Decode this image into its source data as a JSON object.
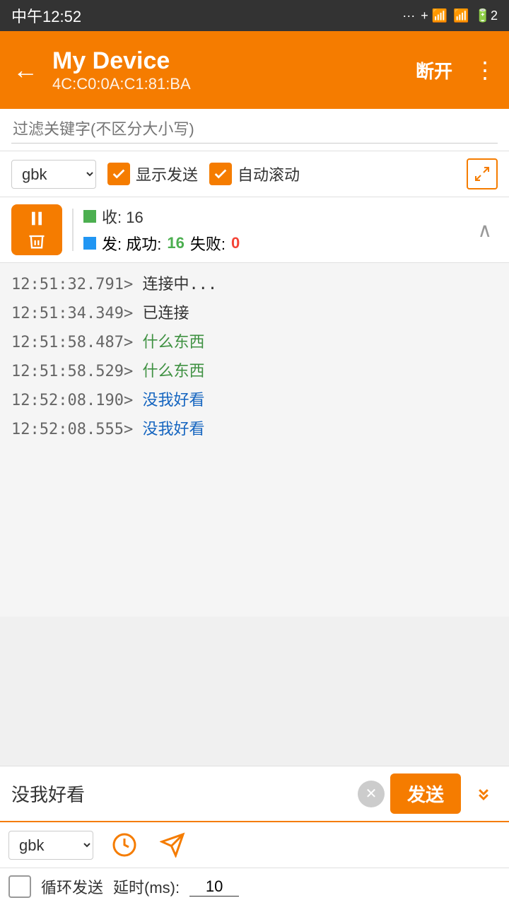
{
  "statusBar": {
    "time": "中午12:52",
    "battery": "2"
  },
  "topBar": {
    "deviceName": "My Device",
    "macAddress": "4C:C0:0A:C1:81:BA",
    "disconnectLabel": "断开",
    "moreLabel": "⋮"
  },
  "filterBar": {
    "placeholder": "过滤关键字(不区分大小写)"
  },
  "controlsBar": {
    "encoding": "gbk",
    "showSendLabel": "显示发送",
    "autoScrollLabel": "自动滚动"
  },
  "statsBar": {
    "recvLabel": "收: 16",
    "sendLabel": "发: 成功: 16 失败: 0",
    "sendSuccess": "16",
    "sendFail": "0"
  },
  "logLines": [
    {
      "timestamp": "12:51:32.791>",
      "message": "连接中...",
      "type": "normal"
    },
    {
      "timestamp": "12:51:34.349>",
      "message": "已连接",
      "type": "normal"
    },
    {
      "timestamp": "12:51:58.487>",
      "message": "什么东西",
      "type": "received"
    },
    {
      "timestamp": "12:51:58.529>",
      "message": "什么东西",
      "type": "received"
    },
    {
      "timestamp": "12:52:08.190>",
      "message": "没我好看",
      "type": "sent"
    },
    {
      "timestamp": "12:52:08.555>",
      "message": "没我好看",
      "type": "sent"
    }
  ],
  "inputArea": {
    "messageValue": "没我好看",
    "sendLabel": "发送",
    "encoding2": "gbk",
    "loopLabel": "循环发送",
    "delayLabel": "延时(ms):",
    "delayValue": "10"
  }
}
